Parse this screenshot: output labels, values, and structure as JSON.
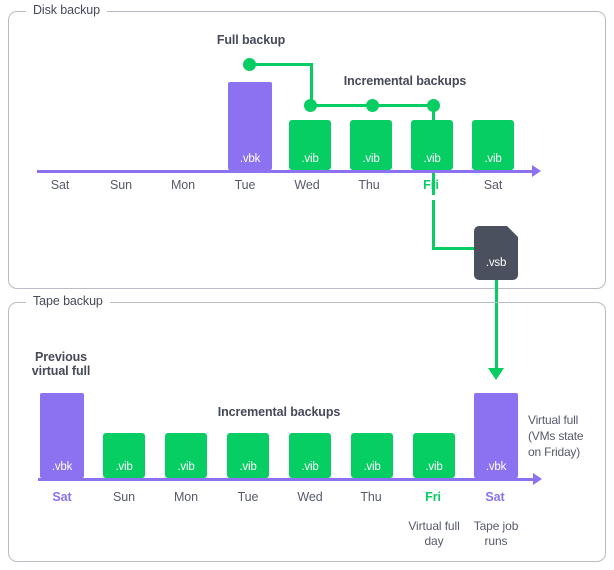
{
  "panels": {
    "disk": {
      "label": "Disk backup"
    },
    "tape": {
      "label": "Tape backup"
    }
  },
  "disk_section": {
    "headings": {
      "full_backup": "Full backup",
      "incremental_backups": "Incremental backups"
    },
    "days": [
      {
        "label": "Sat",
        "accent": "none"
      },
      {
        "label": "Sun",
        "accent": "none"
      },
      {
        "label": "Mon",
        "accent": "none"
      },
      {
        "label": "Tue",
        "accent": "none"
      },
      {
        "label": "Wed",
        "accent": "none"
      },
      {
        "label": "Thu",
        "accent": "none"
      },
      {
        "label": "Fri",
        "accent": "green"
      },
      {
        "label": "Sat",
        "accent": "none"
      }
    ],
    "bars": [
      {
        "day": "Tue",
        "type": "vbk",
        "label": ".vbk"
      },
      {
        "day": "Wed",
        "type": "vib",
        "label": ".vib"
      },
      {
        "day": "Thu",
        "type": "vib",
        "label": ".vib"
      },
      {
        "day": "Fri",
        "type": "vib",
        "label": ".vib"
      },
      {
        "day": "Sat",
        "type": "vib",
        "label": ".vib"
      }
    ],
    "file": {
      "label": ".vsb"
    }
  },
  "tape_section": {
    "headings": {
      "previous_virtual_full": "Previous\nvirtual full",
      "previous_virtual_full_line1": "Previous",
      "previous_virtual_full_line2": "virtual full",
      "incremental_backups": "Incremental backups"
    },
    "days": [
      {
        "label": "Sat",
        "accent": "purple"
      },
      {
        "label": "Sun",
        "accent": "none"
      },
      {
        "label": "Mon",
        "accent": "none"
      },
      {
        "label": "Tue",
        "accent": "none"
      },
      {
        "label": "Wed",
        "accent": "none"
      },
      {
        "label": "Thu",
        "accent": "none"
      },
      {
        "label": "Fri",
        "accent": "green"
      },
      {
        "label": "Sat",
        "accent": "purple"
      }
    ],
    "bars": [
      {
        "day": "Sat",
        "type": "vbk",
        "label": ".vbk"
      },
      {
        "day": "Sun",
        "type": "vib",
        "label": ".vib"
      },
      {
        "day": "Mon",
        "type": "vib",
        "label": ".vib"
      },
      {
        "day": "Tue",
        "type": "vib",
        "label": ".vib"
      },
      {
        "day": "Wed",
        "type": "vib",
        "label": ".vib"
      },
      {
        "day": "Thu",
        "type": "vib",
        "label": ".vib"
      },
      {
        "day": "Fri",
        "type": "vib",
        "label": ".vib"
      },
      {
        "day": "Sat",
        "type": "vbk",
        "label": ".vbk"
      }
    ],
    "notes": {
      "virtual_full_day_line1": "Virtual full",
      "virtual_full_day_line2": "day",
      "tape_job_runs_line1": "Tape job",
      "tape_job_runs_line2": "runs",
      "virtual_full_right_line1": "Virtual full",
      "virtual_full_right_line2": "(VMs state",
      "virtual_full_right_line3": "on Friday)"
    }
  },
  "colors": {
    "purple": "#8c72f0",
    "green": "#06ce63",
    "file_gray": "#4a505e",
    "text": "#565a6b",
    "heading_text": "#46495a",
    "border": "#b9bcc4"
  }
}
